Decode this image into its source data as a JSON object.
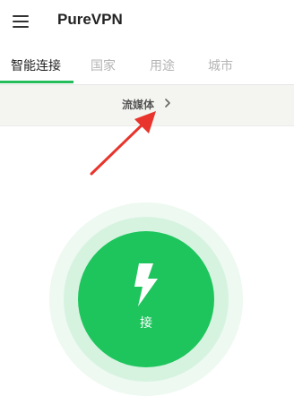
{
  "app": {
    "title": "PureVPN",
    "accent_color": "#25bd5c",
    "menu_icon": "hamburger-menu-icon"
  },
  "tabs": [
    {
      "label": "智能连接",
      "active": true
    },
    {
      "label": "国家",
      "active": false
    },
    {
      "label": "用途",
      "active": false
    },
    {
      "label": "城市",
      "active": false
    }
  ],
  "streaming": {
    "label": "流媒体",
    "icon": "chevron-right-icon"
  },
  "connect": {
    "label": "接",
    "icon": "lightning-bolt-icon",
    "color": "#1ec55d"
  },
  "annotation": {
    "icon": "red-arrow-icon",
    "color": "#e8342c"
  }
}
